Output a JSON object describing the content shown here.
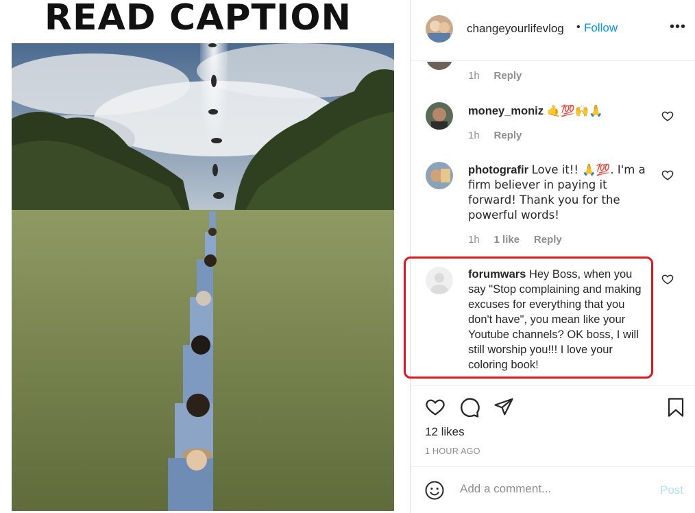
{
  "media": {
    "title": "READ CAPTION"
  },
  "header": {
    "username": "changeyourlifevlog",
    "separator": "•",
    "follow_label": "Follow",
    "more_label": "•••"
  },
  "comments": [
    {
      "username": "",
      "text": "",
      "time": "1h",
      "likes": "",
      "reply_label": "Reply"
    },
    {
      "username": "money_moniz",
      "text": "🤙💯🙌🙏",
      "time": "1h",
      "likes": "",
      "reply_label": "Reply"
    },
    {
      "username": "photografir",
      "text": "Love it!! 🙏💯. I'm a firm believer in paying it forward! Thank you for the powerful words!",
      "time": "1h",
      "likes": "1 like",
      "reply_label": "Reply"
    },
    {
      "username": "forumwars",
      "text": "Hey Boss, when you say \"Stop complaining and making excuses for everything that you don't have\", you mean like your Youtube channels? OK boss, I will still worship you!!! I love your coloring book!",
      "highlighted": true
    }
  ],
  "icons": {
    "like": "heart-icon",
    "comment": "comment-icon",
    "share": "paper-plane-icon",
    "save": "bookmark-icon",
    "emoji": "smiley-icon"
  },
  "post": {
    "likes": "12 likes",
    "time_ago": "1 HOUR AGO"
  },
  "add_comment": {
    "placeholder": "Add a comment...",
    "post_label": "Post"
  },
  "colors": {
    "accent": "#0095f6",
    "post_disabled": "#b2dffc",
    "highlight": "#e1171e",
    "muted": "#8e8e8e"
  }
}
